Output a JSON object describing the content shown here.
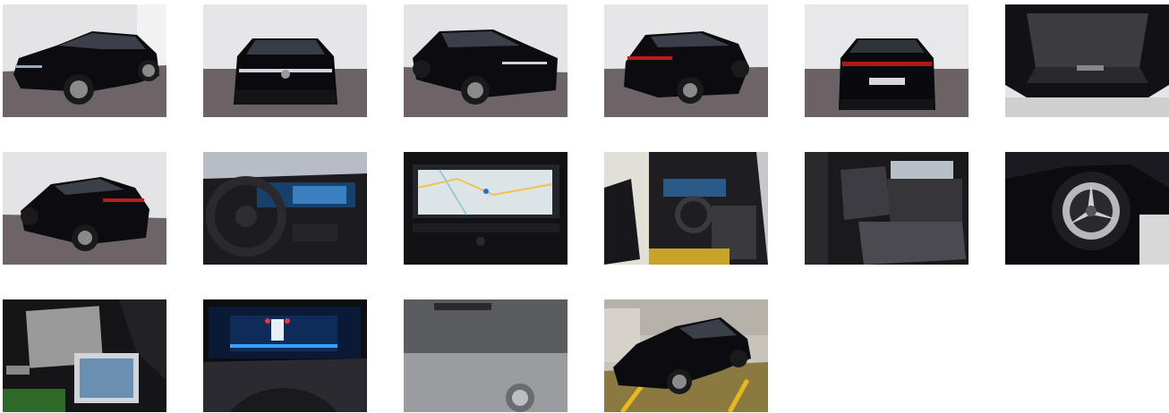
{
  "gallery": {
    "thumbnails": [
      {
        "view": "front-left-exterior",
        "icon": "car-photo-icon"
      },
      {
        "view": "front-exterior",
        "icon": "car-photo-icon"
      },
      {
        "view": "front-right-exterior",
        "icon": "car-photo-icon"
      },
      {
        "view": "rear-right-exterior",
        "icon": "car-photo-icon"
      },
      {
        "view": "rear-exterior",
        "icon": "car-photo-icon"
      },
      {
        "view": "trunk-interior",
        "icon": "trunk-photo-icon"
      },
      {
        "view": "rear-left-exterior",
        "icon": "car-photo-icon"
      },
      {
        "view": "dashboard-cockpit",
        "icon": "dashboard-photo-icon"
      },
      {
        "view": "navigation-screen",
        "icon": "map-screen-photo-icon"
      },
      {
        "view": "driver-door-open",
        "icon": "interior-photo-icon"
      },
      {
        "view": "rear-seats",
        "icon": "seat-photo-icon"
      },
      {
        "view": "wheel-rim",
        "icon": "wheel-photo-icon"
      },
      {
        "view": "documents-on-seat",
        "icon": "document-photo-icon"
      },
      {
        "view": "instrument-cluster",
        "icon": "gauge-photo-icon"
      },
      {
        "view": "windshield-detail",
        "icon": "glass-photo-icon"
      },
      {
        "view": "front-left-warehouse",
        "icon": "car-photo-icon"
      }
    ],
    "colors": {
      "studio_wall": "#e6e6e8",
      "studio_floor": "#6e6668",
      "car_body": "#0c0c10",
      "warehouse_floor": "#8a7a40",
      "floor_marking": "#e8b820"
    }
  }
}
